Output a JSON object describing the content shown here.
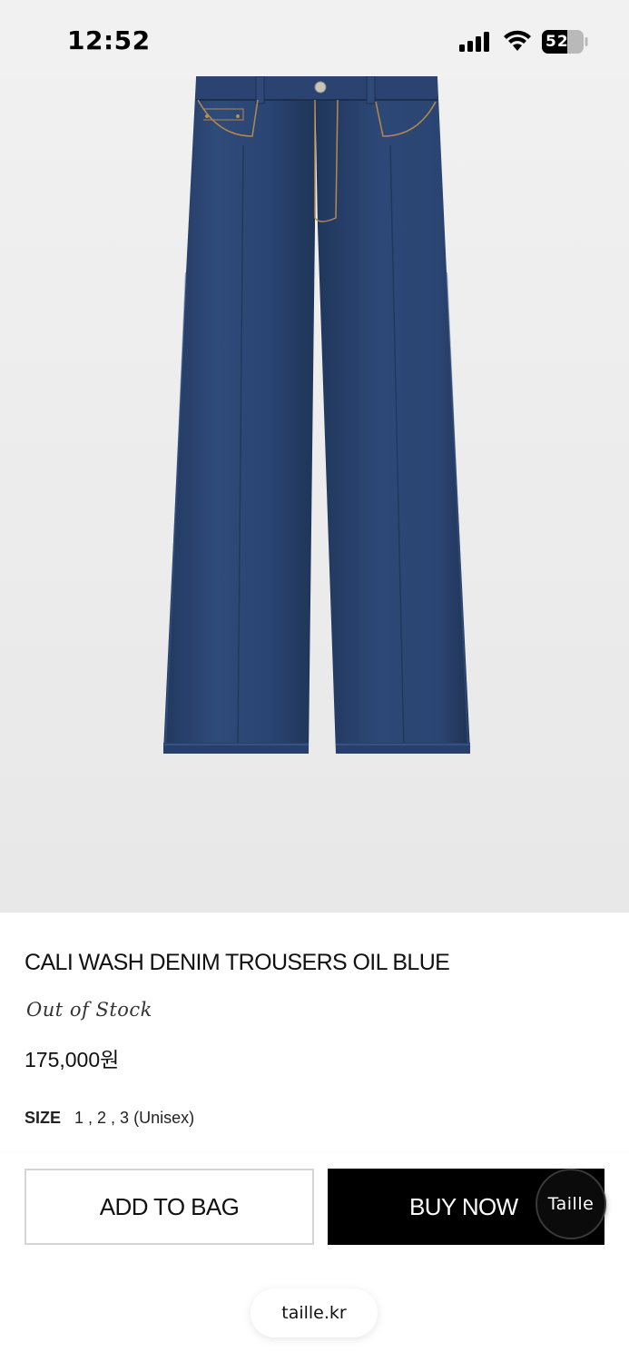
{
  "status_bar": {
    "time": "12:52",
    "battery_level": "52",
    "icons": [
      "signal-icon",
      "wifi-icon",
      "battery-icon"
    ]
  },
  "product": {
    "image_icon": "jeans-product-image",
    "title": "CALI WASH DENIM TROUSERS OIL BLUE",
    "stock_status": "Out of Stock",
    "price": "175,000원",
    "size_label": "SIZE",
    "size_value": "1 , 2 , 3 (Unisex)"
  },
  "actions": {
    "add_to_bag": "ADD TO BAG",
    "buy_now": "BUY NOW",
    "floating_badge": "Taille"
  },
  "browser": {
    "domain": "taille.kr"
  },
  "colors": {
    "denim": "#2b4470",
    "background": "#ececec",
    "buy_button": "#000000"
  }
}
